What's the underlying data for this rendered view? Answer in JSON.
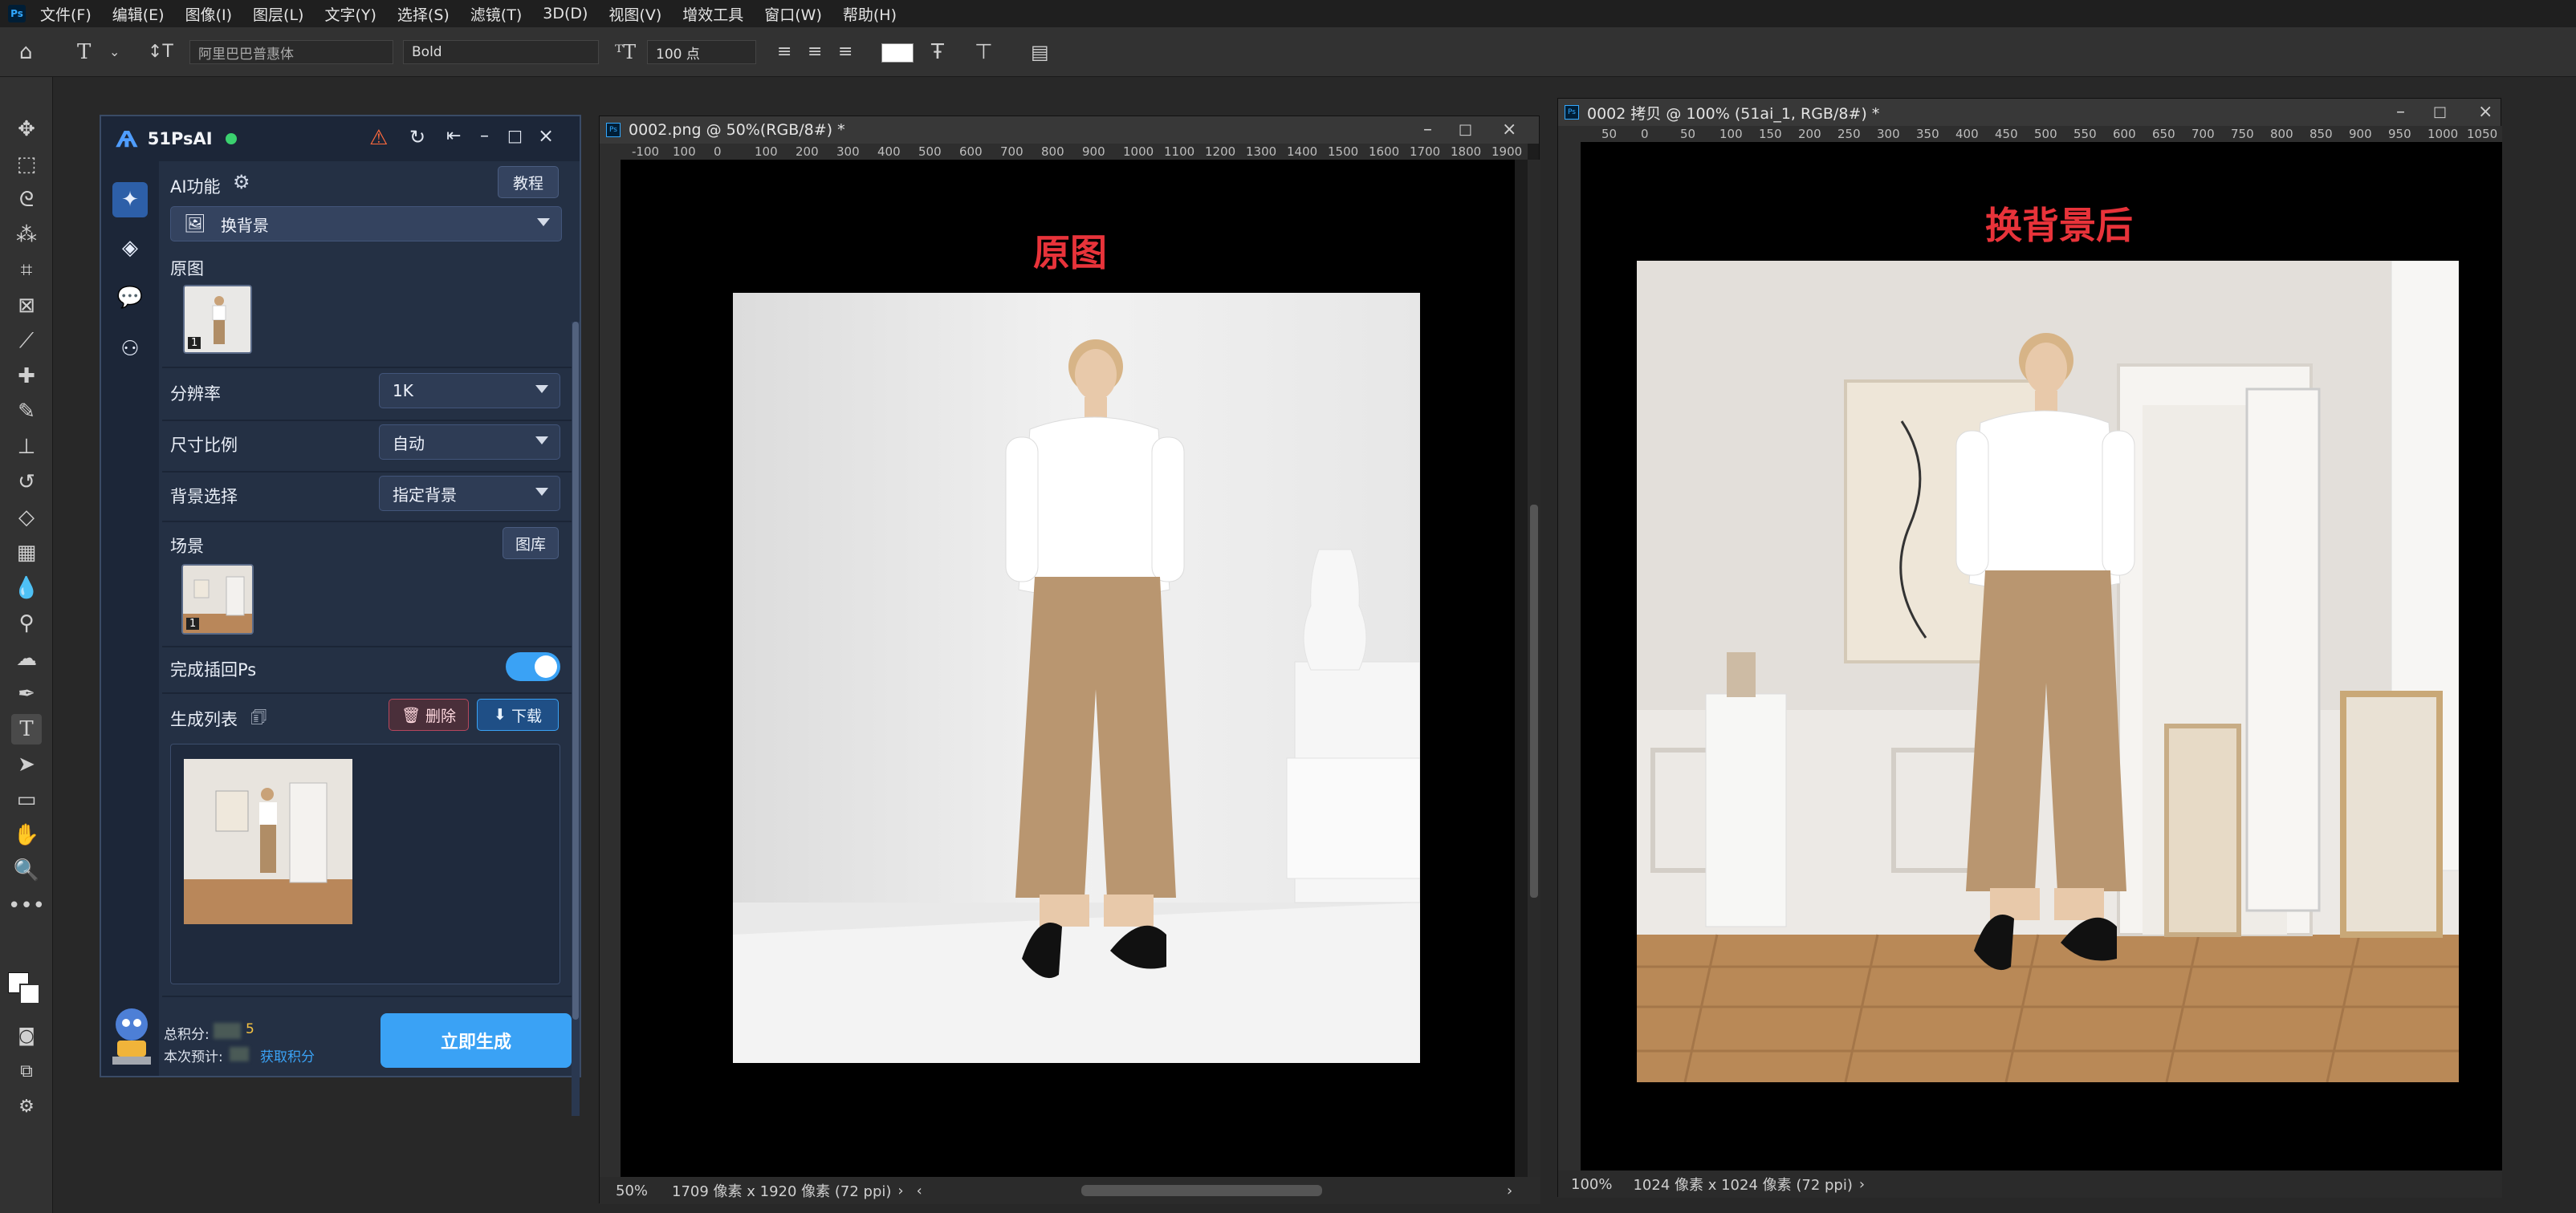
{
  "menubar": {
    "logo": "Ps",
    "items": [
      "文件(F)",
      "编辑(E)",
      "图像(I)",
      "图层(L)",
      "文字(Y)",
      "选择(S)",
      "滤镜(T)",
      "3D(D)",
      "视图(V)",
      "增效工具",
      "窗口(W)",
      "帮助(H)"
    ]
  },
  "options": {
    "font_family": "阿里巴巴普惠体",
    "font_style": "Bold",
    "font_size": "100 点"
  },
  "plugin": {
    "title": "51PsAI",
    "ai_function_label": "AI功能",
    "tutorial_button": "教程",
    "function_select": "换背景",
    "original_label": "原图",
    "original_count": "1",
    "resolution_label": "分辨率",
    "resolution_value": "1K",
    "ratio_label": "尺寸比例",
    "ratio_value": "自动",
    "bg_label": "背景选择",
    "bg_value": "指定背景",
    "scene_label": "场景",
    "gallery_button": "图库",
    "scene_count": "1",
    "insert_back_label": "完成插回Ps",
    "insert_back_enabled": true,
    "gen_list_label": "生成列表",
    "delete_button": "删除",
    "download_button": "下载",
    "points_total_label": "总积分:",
    "points_total_value": "5",
    "estimate_label": "本次预计:",
    "get_points_link": "获取积分",
    "generate_button": "立即生成",
    "status_color": "#3bd16f",
    "accent": "#3aa2f5"
  },
  "doc1": {
    "title": "0002.png @ 50%(RGB/8#) *",
    "ruler_ticks": [
      "-100",
      "100",
      "0",
      "100",
      "200",
      "300",
      "400",
      "500",
      "600",
      "700",
      "800",
      "900",
      "1000",
      "1100",
      "1200",
      "1300",
      "1400",
      "1500",
      "1600",
      "1700",
      "1800",
      "1900"
    ],
    "canvas_label": "原图",
    "zoom": "50%",
    "info": "1709 像素 x 1920 像素 (72 ppi)"
  },
  "doc2": {
    "title": "0002 拷贝 @ 100% (51ai_1, RGB/8#) *",
    "ruler_ticks": [
      "50",
      "0",
      "50",
      "100",
      "150",
      "200",
      "250",
      "300",
      "350",
      "400",
      "450",
      "500",
      "550",
      "600",
      "650",
      "700",
      "750",
      "800",
      "850",
      "900",
      "950",
      "1000",
      "1050"
    ],
    "canvas_label": "换背景后",
    "zoom": "100%",
    "info": "1024 像素 x 1024 像素 (72 ppi)"
  }
}
